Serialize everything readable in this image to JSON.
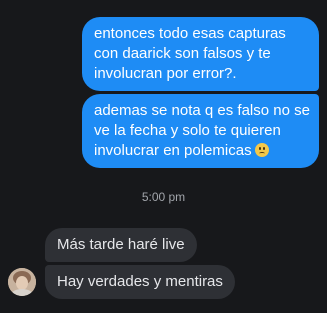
{
  "messages_outgoing": [
    {
      "lines": [
        "entonces todo esas capturas",
        "con daarick son falsos y te",
        "involucran por error?."
      ]
    },
    {
      "lines": [
        "ademas se nota q es falso no se",
        "ve la fecha y solo te quieren",
        "involucrar en polemicas"
      ],
      "emoji": "frowning-face-emoji"
    }
  ],
  "timestamp": "5:00 pm",
  "messages_incoming": [
    {
      "text": "Más tarde haré live"
    },
    {
      "text": "Hay verdades y mentiras"
    }
  ],
  "contact": {
    "avatar_icon": "contact-avatar"
  },
  "colors": {
    "background": "#17181b",
    "outgoing_bubble": "#1e8cf5",
    "incoming_bubble": "#2e3035",
    "timestamp_text": "#a2a5ab"
  }
}
